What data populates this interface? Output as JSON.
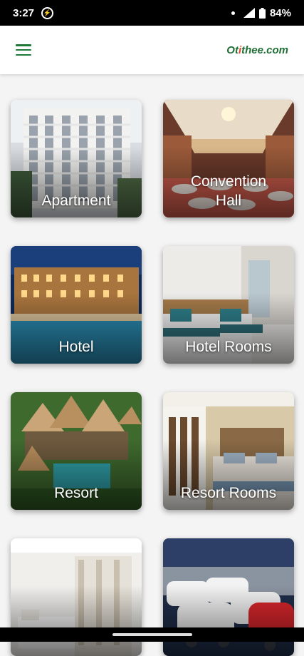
{
  "status": {
    "time": "3:27",
    "battery": "84%",
    "icons": [
      "messenger-icon",
      "signal-icon",
      "battery-icon"
    ]
  },
  "header": {
    "logo_part1": "Ot",
    "logo_accent": "i",
    "logo_part2": "thee.com",
    "menu_icon": "hamburger-menu-icon"
  },
  "categories": [
    {
      "label": "Apartment"
    },
    {
      "label": "Convention\nHall"
    },
    {
      "label": "Hotel"
    },
    {
      "label": "Hotel Rooms"
    },
    {
      "label": "Resort"
    },
    {
      "label": "Resort Rooms"
    },
    {
      "label": ""
    },
    {
      "label": ""
    }
  ],
  "colors": {
    "brand_green": "#1f6e35",
    "brand_red": "#e0432b"
  }
}
